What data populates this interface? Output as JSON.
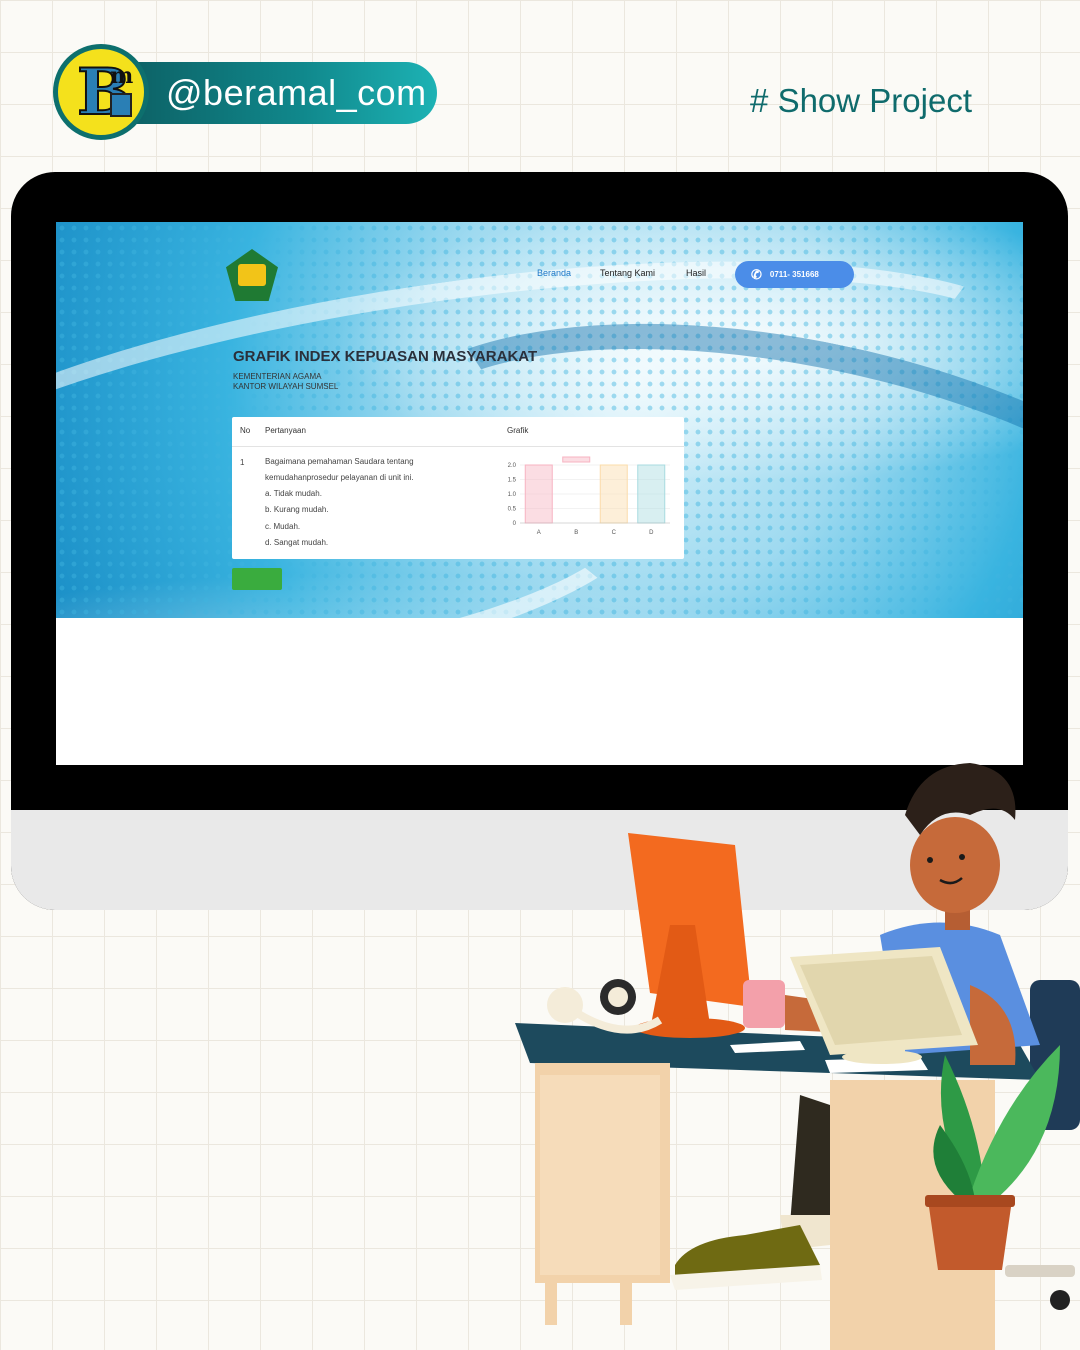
{
  "brand": {
    "handle": "@beramal_com",
    "tag": "# Show Project"
  },
  "site": {
    "nav": [
      "Beranda",
      "Tentang Kami",
      "Hasil"
    ],
    "phone": "0711- 351668",
    "title": "GRAFIK INDEX KEPUASAN MASYARAKAT",
    "subtitle_1": "KEMENTERIAN AGAMA",
    "subtitle_2": "KANTOR WILAYAH SUMSEL",
    "table": {
      "headers": [
        "No",
        "Pertanyaan",
        "Grafik"
      ],
      "rows": [
        {
          "no": "1",
          "question": [
            "Bagaimana pemahaman Saudara tentang",
            "kemudahanprosedur pelayanan di unit ini."
          ],
          "options": [
            "a. Tidak mudah.",
            "b. Kurang mudah.",
            "c. Mudah.",
            "d. Sangat mudah."
          ]
        }
      ]
    }
  },
  "chart_data": {
    "type": "bar",
    "categories": [
      "A",
      "B",
      "C",
      "D"
    ],
    "values": [
      2,
      0,
      2,
      2
    ],
    "yticks": [
      "2.0",
      "1.5",
      "1.0",
      "0.5",
      "0"
    ],
    "ylim": [
      0,
      2
    ],
    "colors": [
      "#f7b3c2",
      "#f7b3c2",
      "#fbdcaa",
      "#a8dbe0"
    ],
    "grid": true
  }
}
